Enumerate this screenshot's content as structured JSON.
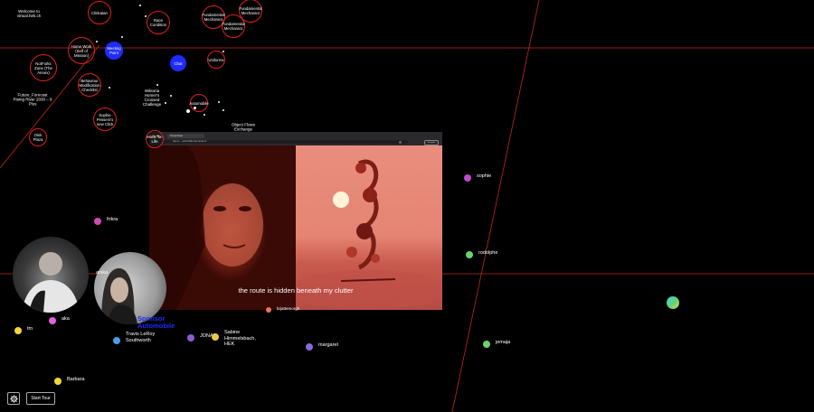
{
  "map_nodes": [
    {
      "label": "Welcome to virtual.hek.ch",
      "style": "plain"
    },
    {
      "label": "Clinkatan",
      "style": "ring"
    },
    {
      "label": "Race Condition",
      "style": "ring"
    },
    {
      "label": "Fundamental Mechanics",
      "style": "ring"
    },
    {
      "label": "Fundamental Mechanics",
      "style": "ring"
    },
    {
      "label": "Fundamental Mechanics",
      "style": "ring"
    },
    {
      "label": "Home Work (Self of Mission)",
      "style": "ring"
    },
    {
      "label": "Meeting Point",
      "style": "blue"
    },
    {
      "label": "Chat",
      "style": "blue"
    },
    {
      "label": "Uniforms",
      "style": "ring"
    },
    {
      "label": "NotForks Zone (The Annex)",
      "style": "ring"
    },
    {
      "label": "Behaviour Modification Checklist",
      "style": "ring"
    },
    {
      "label": "Future_Forecast Rising River 2030 – 9 Plus",
      "style": "plain"
    },
    {
      "label": "Wiktoria Homer's Crossed Challenge",
      "style": "plain"
    },
    {
      "label": "Automobile",
      "style": "ring"
    },
    {
      "label": "Sophie Pessers's new Click",
      "style": "ring"
    },
    {
      "label": "Object Flows Exchange Request",
      "style": "plain"
    },
    {
      "label": "Oink Plaza",
      "style": "ring"
    },
    {
      "label": "Monk Ta-Life",
      "style": "ring"
    }
  ],
  "colors": {
    "background": "#000000",
    "ring": "#e02020",
    "accent_blue": "#1f2bff",
    "grid_line": "#c0281e"
  },
  "users": [
    {
      "name": "sophie",
      "color": "#c04ac8"
    },
    {
      "name": "frikra",
      "color": "#d24ab6"
    },
    {
      "name": "rodolphe",
      "color": "#6bd36a"
    },
    {
      "name": "anika",
      "color": "#c8c8c8"
    },
    {
      "name": "aka",
      "color": "#e060e0"
    },
    {
      "name": "tm",
      "color": "#f2d63a"
    },
    {
      "name": "Travis LeRoy Southworth",
      "color": "#4a9be8"
    },
    {
      "name": "JONAS",
      "color": "#8a5cd0"
    },
    {
      "name": "Sabine Himmelsbach, HEK",
      "color": "#e8c84a"
    },
    {
      "name": "margaret",
      "color": "#8a6ad8"
    },
    {
      "name": "jemaja",
      "color": "#6bd36a"
    },
    {
      "name": "Barbara",
      "color": "#f2d63a"
    },
    {
      "name": "brjattemorgh",
      "color": "#e07a5a"
    }
  ],
  "video_panel": {
    "tab_title": "Screenshare",
    "url": "hek.ch — automobile.hek-virtual.ch",
    "profile_label": "Incognito",
    "caption": "the route is hidden beneath my clutter"
  },
  "sponsor_text": "Sponsor Automobile",
  "controls": {
    "settings_icon": "gear-icon",
    "start_tour": "Start Tour"
  }
}
